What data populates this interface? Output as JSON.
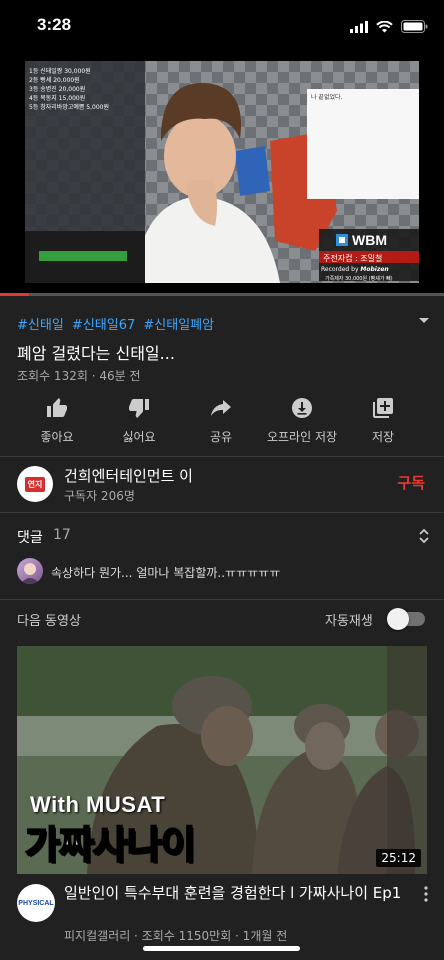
{
  "status_bar": {
    "time": "3:28"
  },
  "player": {
    "progress_fraction": 0.065,
    "overlay": {
      "top_list_lines": [
        "1등 신태일짱 30,000원",
        "2등 빵셰 20,000원",
        "3등 송병진 20,000원",
        "4등 목동지 15,000원",
        "5등 창자리바망고예쁨 5,000원"
      ],
      "brand": "WBM",
      "banner": "주전자컵 : 조밀철",
      "recorded_by": "Recorded by",
      "recorded_tool": "Mobizen",
      "bottom_caption": "가족제자 30,000원 (빵셰가 빼)",
      "small_window_text": "나 끝없었다."
    }
  },
  "video": {
    "hashtags": [
      "#신태일",
      "#신태일67",
      "#신태일폐암"
    ],
    "title": "폐암 걸렸다는 신태일...",
    "meta": "조회수 132회 · 46분 전",
    "actions": [
      {
        "label": "좋아요",
        "icon": "thumbs-up-icon"
      },
      {
        "label": "싫어요",
        "icon": "thumbs-down-icon"
      },
      {
        "label": "공유",
        "icon": "share-icon"
      },
      {
        "label": "오프라인 저장",
        "icon": "download-icon"
      },
      {
        "label": "저장",
        "icon": "add-to-playlist-icon"
      }
    ]
  },
  "channel": {
    "avatar_text": "연지",
    "name": "건희엔터테인먼트 이",
    "subscribers": "구독자 206명",
    "subscribe_label": "구독"
  },
  "comments": {
    "label": "댓글",
    "count": "17",
    "top_comment": "속상하다 뭔가... 얼마나 복잡할까..ㅠㅠㅠㅠㅠ"
  },
  "up_next": {
    "label": "다음 동영상",
    "autoplay_label": "자동재생",
    "autoplay_on": false
  },
  "recommended": {
    "thumbnail_caption_top": "With MUSAT",
    "thumbnail_caption_main": "가짜사나이",
    "duration": "25:12",
    "channel_avatar_text": "PHYSICAL",
    "title": "일반인이 특수부대 훈련을 경험한다 l 가짜사나이 Ep1",
    "meta": "피지컬갤러리 · 조회수 1150만회 · 1개월 전"
  }
}
